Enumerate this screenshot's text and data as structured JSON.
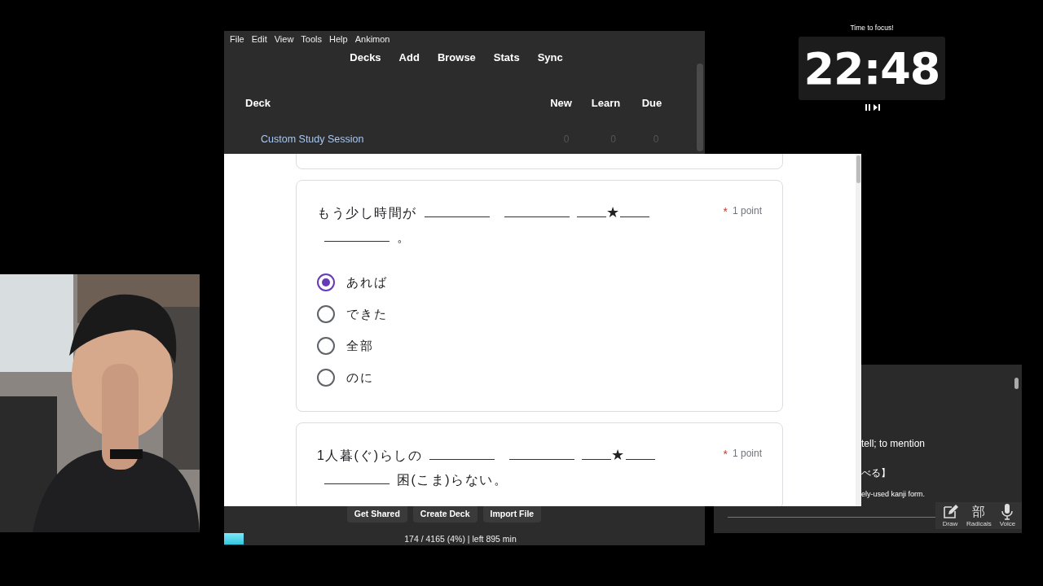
{
  "anki": {
    "menu": [
      "File",
      "Edit",
      "View",
      "Tools",
      "Help",
      "Ankimon"
    ],
    "toolbar": [
      "Decks",
      "Add",
      "Browse",
      "Stats",
      "Sync"
    ],
    "columns": [
      "Deck",
      "New",
      "Learn",
      "Due"
    ],
    "decks": [
      {
        "name": "Custom Study Session",
        "new": "0",
        "learn": "0",
        "due": "0"
      }
    ],
    "buttons": [
      "Get Shared",
      "Create Deck",
      "Import File"
    ],
    "progress": {
      "level": 0.04
    },
    "status": "174 / 4165 (4%) | left 895 min"
  },
  "form": {
    "questions": [
      {
        "parts": [
          {
            "kind": "text",
            "text": "もう少し時間が"
          },
          {
            "kind": "blank"
          },
          {
            "kind": "blank"
          },
          {
            "kind": "star",
            "text": "★"
          },
          {
            "kind": "blank"
          },
          {
            "kind": "text",
            "text": "。"
          }
        ],
        "required_mark": "*",
        "points": "1 point",
        "options": [
          {
            "label": "あれば",
            "selected": true
          },
          {
            "label": "できた",
            "selected": false
          },
          {
            "label": "全部",
            "selected": false
          },
          {
            "label": "のに",
            "selected": false
          }
        ]
      },
      {
        "parts": [
          {
            "kind": "text",
            "text": "1人暮(ぐ)らしの"
          },
          {
            "kind": "blank"
          },
          {
            "kind": "blank"
          },
          {
            "kind": "star",
            "text": "★"
          },
          {
            "kind": "blank"
          },
          {
            "kind": "text",
            "text": "困(こま)らない。"
          }
        ],
        "required_mark": "*",
        "points": "1 point"
      }
    ]
  },
  "timer": {
    "caption": "Time to focus!",
    "time": "22:48"
  },
  "dictionary": {
    "lines": [
      "tell; to mention",
      "べる】",
      "ely-used kanji form."
    ],
    "tools": [
      {
        "kind": "draw",
        "label": "Draw"
      },
      {
        "kind": "glyph",
        "glyph": "部",
        "label": "Radicals"
      },
      {
        "kind": "voice",
        "label": "Voice"
      }
    ]
  }
}
